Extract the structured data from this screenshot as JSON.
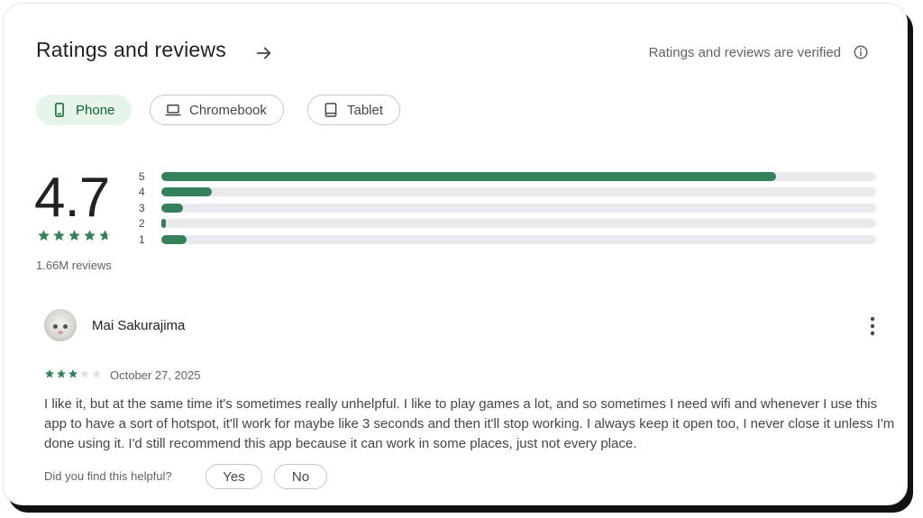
{
  "header": {
    "title": "Ratings and reviews",
    "verified_text": "Ratings and reviews are verified"
  },
  "device_tabs": [
    {
      "label": "Phone",
      "icon": "phone-icon",
      "active": true
    },
    {
      "label": "Chromebook",
      "icon": "laptop-icon",
      "active": false
    },
    {
      "label": "Tablet",
      "icon": "tablet-icon",
      "active": false
    }
  ],
  "summary": {
    "rating": "4.7",
    "stars": 4.7,
    "review_count": "1.66M reviews",
    "distribution": [
      {
        "label": "5",
        "fraction": 0.86
      },
      {
        "label": "4",
        "fraction": 0.07
      },
      {
        "label": "3",
        "fraction": 0.03
      },
      {
        "label": "2",
        "fraction": 0.006
      },
      {
        "label": "1",
        "fraction": 0.035
      }
    ]
  },
  "review": {
    "author": "Mai Sakurajima",
    "stars": 3,
    "date": "October 27, 2025",
    "text": "I like it, but at the same time it's sometimes really unhelpful. I like to play games a lot, and so sometimes I need wifi and whenever I use this app to have a sort of hotspot, it'll work for maybe like 3 seconds and then it'll stop working. I always keep it open too, I never close it unless I'm done using it. I'd still recommend this app because it can work in some places, just not every place.",
    "helpful_prompt": "Did you find this helpful?",
    "yes_label": "Yes",
    "no_label": "No"
  },
  "colors": {
    "accent_green": "#34815c",
    "star_green": "#34815c",
    "chip_active_bg": "#e6f4ea",
    "track_gray": "#e8eaed"
  }
}
